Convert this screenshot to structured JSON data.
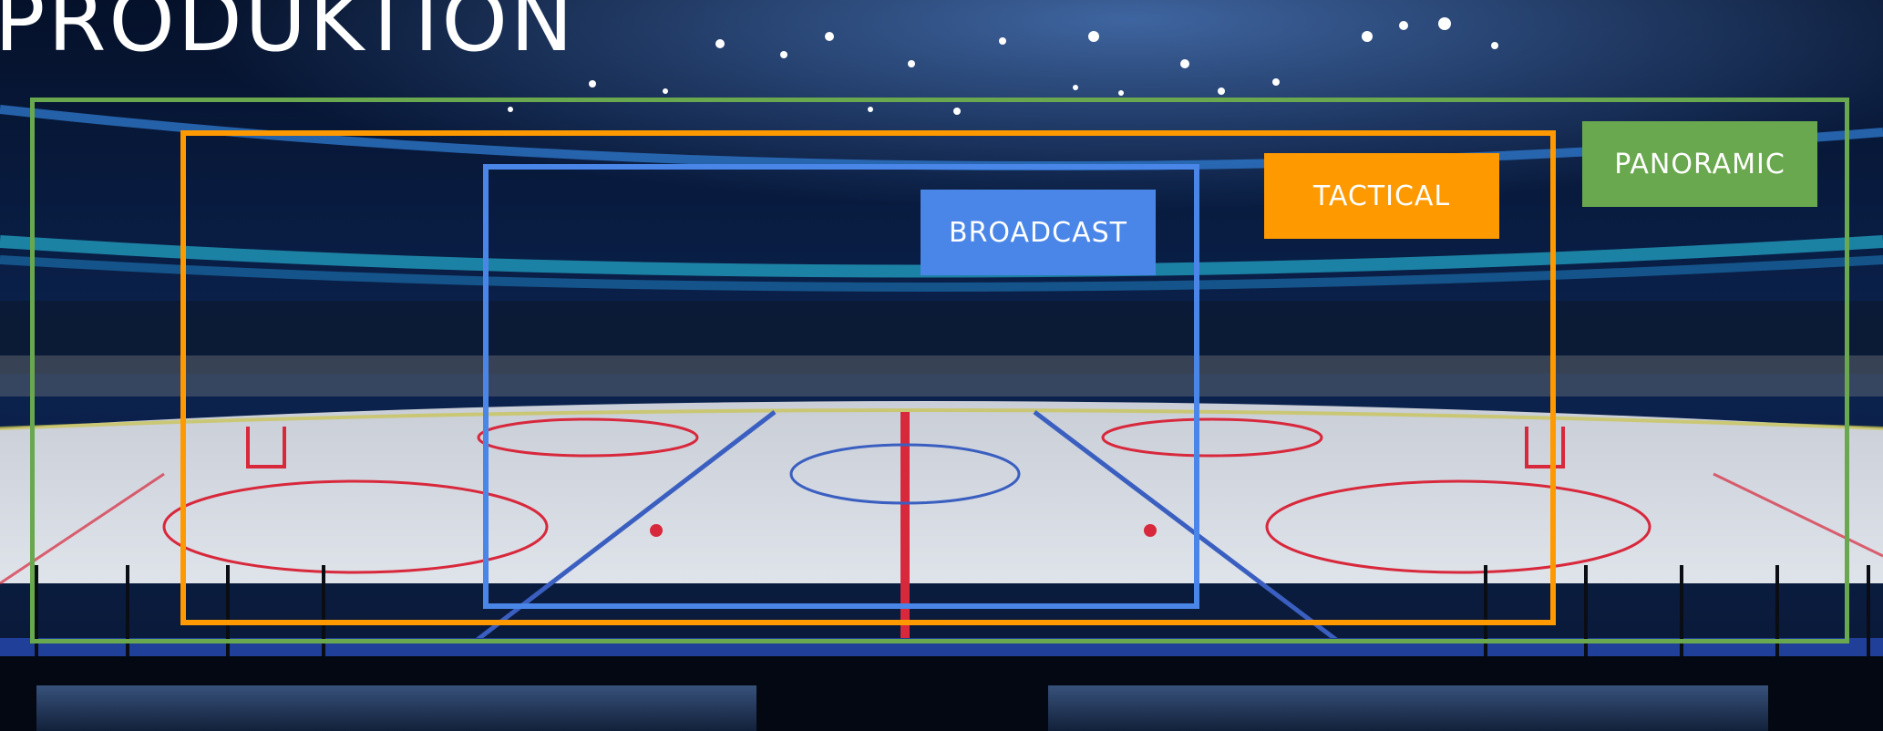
{
  "page": {
    "title": "PRODUKTION"
  },
  "views": [
    {
      "id": "broadcast",
      "label": "BROADCAST",
      "color": "#4a86e8"
    },
    {
      "id": "tactical",
      "label": "TACTICAL",
      "color": "#ff9900"
    },
    {
      "id": "panoramic",
      "label": "PANORAMIC",
      "color": "#6aa84f"
    }
  ],
  "background": {
    "subject": "ice hockey arena rink",
    "colors": {
      "sky": "#0a1a3a",
      "ice": "#d9dde3",
      "redline": "#d8283c",
      "blueline": "#3a5fc0"
    }
  }
}
